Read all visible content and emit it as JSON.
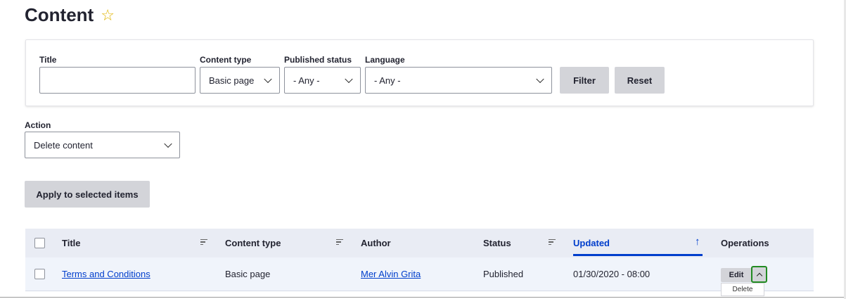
{
  "page": {
    "title": "Content"
  },
  "filters": {
    "title_label": "Title",
    "title_value": "",
    "content_type_label": "Content type",
    "content_type_value": "Basic page",
    "published_status_label": "Published status",
    "published_status_value": "- Any -",
    "language_label": "Language",
    "language_value": "- Any -",
    "filter_button": "Filter",
    "reset_button": "Reset"
  },
  "bulk": {
    "action_label": "Action",
    "action_value": "Delete content",
    "apply_button": "Apply to selected items"
  },
  "table": {
    "headers": {
      "title": "Title",
      "content_type": "Content type",
      "author": "Author",
      "status": "Status",
      "updated": "Updated",
      "operations": "Operations"
    },
    "rows": [
      {
        "title": "Terms and Conditions",
        "content_type": "Basic page",
        "author": "Mer Alvin Grita",
        "status": "Published",
        "updated": "01/30/2020 - 08:00",
        "edit": "Edit",
        "delete": "Delete"
      }
    ]
  },
  "icons": {
    "favorite": "star-icon",
    "sort_active": "arrow-up-icon"
  },
  "colors": {
    "link": "#003ecc",
    "star": "#e0b400",
    "focus": "#228b22"
  }
}
